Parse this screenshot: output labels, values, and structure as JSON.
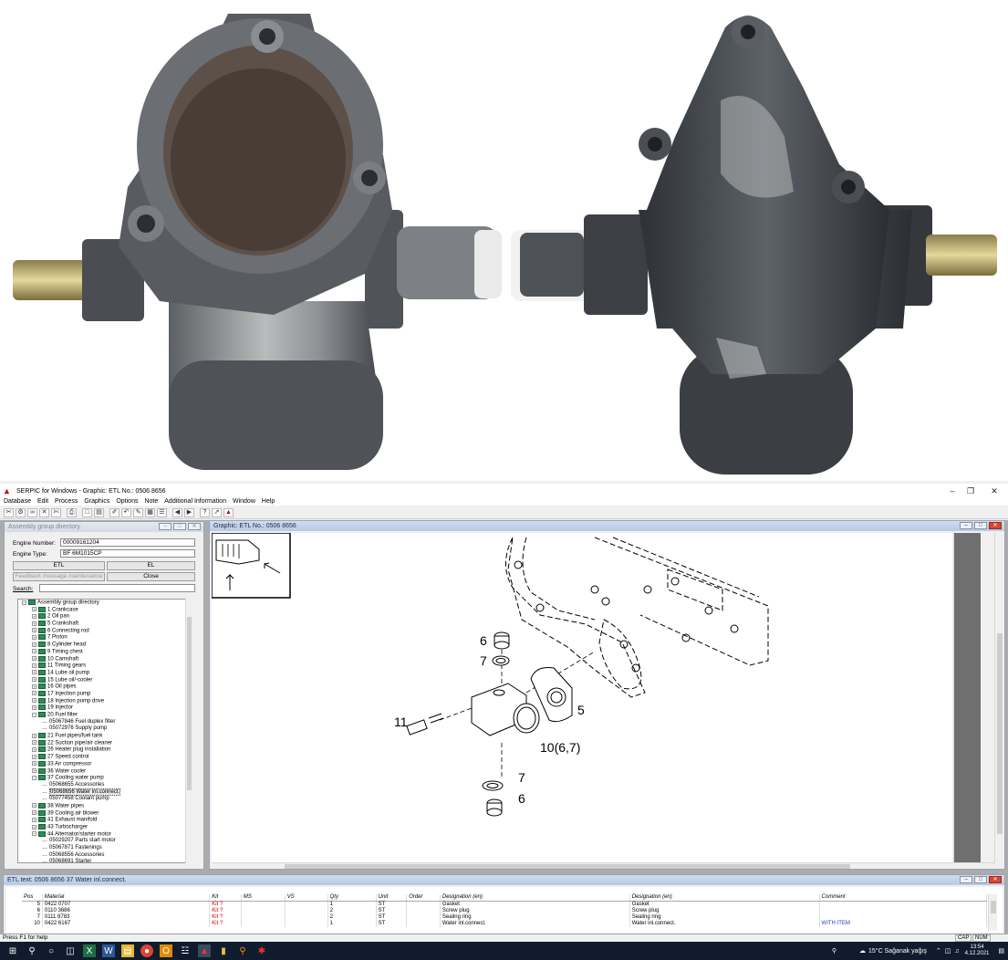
{
  "app": {
    "title": "SERPIC for Windows - Graphic: ETL No.: 0506 8656",
    "logo_icon": "serpic-logo-icon",
    "window_minimize": "–",
    "window_restore": "❐",
    "window_close": "✕"
  },
  "menu": [
    "Database",
    "Edit",
    "Process",
    "Graphics",
    "Options",
    "Note",
    "Additional Information",
    "Window",
    "Help"
  ],
  "assembly_panel": {
    "title": "Assembly group directory",
    "engine_number_label": "Engine Number:",
    "engine_number_value": "00009161204",
    "engine_type_label": "Engine Type:",
    "engine_type_value": "BF 6M1015CP",
    "etl_button": "ETL",
    "el_button": "EL",
    "feedback_button": "Feedback message maintenance",
    "close_button": "Close",
    "search_label": "Search:",
    "search_value": "",
    "tree": [
      {
        "label": "Assembly group directory",
        "level": 0,
        "toggle": "−"
      },
      {
        "label": "1  Crankcase",
        "level": 1,
        "toggle": "+"
      },
      {
        "label": "2  Oil pan",
        "level": 1,
        "toggle": "+"
      },
      {
        "label": "5  Crankshaft",
        "level": 1,
        "toggle": "+"
      },
      {
        "label": "6  Connecting rod",
        "level": 1,
        "toggle": "+"
      },
      {
        "label": "7  Piston",
        "level": 1,
        "toggle": "+"
      },
      {
        "label": "8  Cylinder head",
        "level": 1,
        "toggle": "+"
      },
      {
        "label": "9  Timing chest",
        "level": 1,
        "toggle": "+"
      },
      {
        "label": "10  Camshaft",
        "level": 1,
        "toggle": "+"
      },
      {
        "label": "11  Timing gears",
        "level": 1,
        "toggle": "+"
      },
      {
        "label": "14  Lube oil pump",
        "level": 1,
        "toggle": "+"
      },
      {
        "label": "15  Lube oil/-cooler",
        "level": 1,
        "toggle": "+"
      },
      {
        "label": "16  Oil pipes",
        "level": 1,
        "toggle": "+"
      },
      {
        "label": "17  Injection pump",
        "level": 1,
        "toggle": "+"
      },
      {
        "label": "18  Injection pump drive",
        "level": 1,
        "toggle": "+"
      },
      {
        "label": "19  Injector",
        "level": 1,
        "toggle": "+"
      },
      {
        "label": "20  Fuel filter",
        "level": 1,
        "toggle": "−"
      },
      {
        "label": "05067846  Fuel duplex filter",
        "level": 2,
        "toggle": ""
      },
      {
        "label": "05072976  Supply pump",
        "level": 2,
        "toggle": ""
      },
      {
        "label": "21  Fuel pipes/fuel tank",
        "level": 1,
        "toggle": "+"
      },
      {
        "label": "22  Suction pipe/air cleaner",
        "level": 1,
        "toggle": "+"
      },
      {
        "label": "26  Heater plug installation",
        "level": 1,
        "toggle": "+"
      },
      {
        "label": "27  Speed control",
        "level": 1,
        "toggle": "+"
      },
      {
        "label": "33  Air compressor",
        "level": 1,
        "toggle": "+"
      },
      {
        "label": "36  Water cooler",
        "level": 1,
        "toggle": "+"
      },
      {
        "label": "37  Cooling water pump",
        "level": 1,
        "toggle": "−"
      },
      {
        "label": "05068655  Accessories",
        "level": 2,
        "toggle": ""
      },
      {
        "label": "05068656  Water inl.connect.",
        "level": 2,
        "toggle": "",
        "selected": true
      },
      {
        "label": "05077458  Coolant pump",
        "level": 2,
        "toggle": ""
      },
      {
        "label": "38  Water pipes",
        "level": 1,
        "toggle": "+"
      },
      {
        "label": "39  Cooling air blower",
        "level": 1,
        "toggle": "+"
      },
      {
        "label": "41  Exhaust manifold",
        "level": 1,
        "toggle": "+"
      },
      {
        "label": "43  Turbocharger",
        "level": 1,
        "toggle": "+"
      },
      {
        "label": "44  Alternator/starter motor",
        "level": 1,
        "toggle": "−"
      },
      {
        "label": "05029207  Parts start motor",
        "level": 2,
        "toggle": ""
      },
      {
        "label": "05067871  Fastenings",
        "level": 2,
        "toggle": ""
      },
      {
        "label": "05068556  Accessories",
        "level": 2,
        "toggle": ""
      },
      {
        "label": "05068691  Starter",
        "level": 2,
        "toggle": ""
      }
    ]
  },
  "graphic_panel": {
    "title": "Graphic: ETL No.: 0506 8656",
    "callouts": [
      {
        "text": "6"
      },
      {
        "text": "7"
      },
      {
        "text": "5"
      },
      {
        "text": "11"
      },
      {
        "text": "10(6,7)"
      },
      {
        "text": "7"
      },
      {
        "text": "6"
      }
    ]
  },
  "etl_panel": {
    "title": "ETL text: 0506 8656   37   Water inl.connect.",
    "columns": [
      "Pos",
      "Material",
      "Kit",
      "MS",
      "VS",
      "Qty",
      "Unit",
      "Order",
      "Designation (en)",
      "Designation (en)",
      "Comment"
    ],
    "rows": [
      [
        "5",
        "0422 0707",
        "Kit ?",
        "",
        "",
        "1",
        "ST",
        "",
        "Gasket",
        "Gasket",
        ""
      ],
      [
        "6",
        "0110 3686",
        "Kit ?",
        "",
        "",
        "2",
        "ST",
        "",
        "Screw plug",
        "Screw plug",
        ""
      ],
      [
        "7",
        "0111 8783",
        "Kit ?",
        "",
        "",
        "2",
        "ST",
        "",
        "Sealing ring",
        "Sealing ring",
        ""
      ],
      [
        "10",
        "0422 6167",
        "Kit ?",
        "",
        "",
        "1",
        "ST",
        "",
        "Water inl.connect.",
        "Water inl.connect.",
        "WITH ITEM"
      ]
    ],
    "kit_color": "#cc0000",
    "comment_color": "#1a3fc0"
  },
  "statusbar": {
    "help_text": "Press F1 for help",
    "cap": "CAP",
    "num": "NUM"
  },
  "taskbar": {
    "weather": "15°C  Sağanak yağış",
    "time": "13:54",
    "date": "4.12.2021"
  },
  "colors": {
    "caption_active": "#b7c9e6",
    "mdi_background": "#ababab",
    "taskbar": "#101c2e"
  }
}
